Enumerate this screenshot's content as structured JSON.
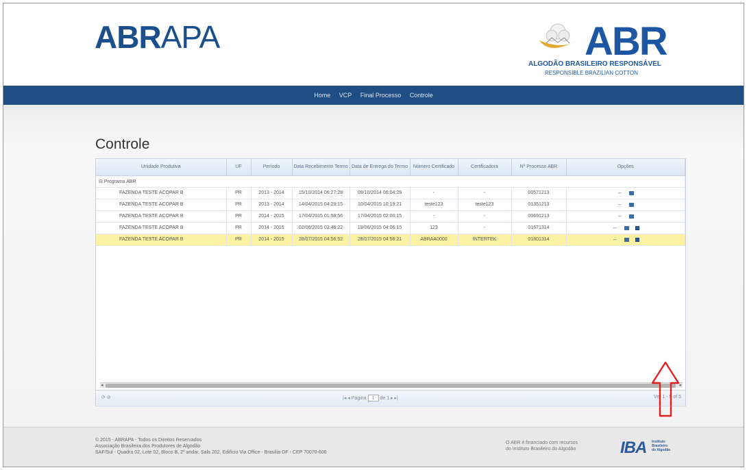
{
  "header": {
    "abrapa_logo_bold": "ABR",
    "abrapa_logo_rest": "APA",
    "abr_logo": "ABR",
    "abr_subtitle": "ALGODÃO BRASILEIRO RESPONSÁVEL",
    "abr_subtitle_en": "RESPONSIBLE BRAZILIAN COTTON"
  },
  "nav": {
    "items": [
      "Home",
      "VCP",
      "Final Processo",
      "Controle"
    ]
  },
  "main": {
    "title": "Controle"
  },
  "grid": {
    "columns": [
      "Unidade Produtiva",
      "UF",
      "Período",
      "Data Recebimento Termo",
      "Data de Entrega do Termo",
      "Número Certificado",
      "Certificadora",
      "Nº Processo ABR",
      "Opções"
    ],
    "group_label": "Programa ABR",
    "rows": [
      [
        "FAZENDA TESTE ACOPAR B",
        "PR",
        "2013 - 2014",
        "15/10/2014 06:27:28",
        "09/10/2014 06:04:29",
        "-",
        "-",
        "00571213"
      ],
      [
        "FAZENDA TESTE ACOPAR B",
        "PR",
        "2013 - 2014",
        "14/04/2015 04:29:15",
        "10/04/2015 10:19:21",
        "teste123",
        "teste123",
        "01351213"
      ],
      [
        "FAZENDA TESTE ACOPAR B",
        "PR",
        "2014 - 2015",
        "17/04/2015 01:58:56",
        "17/04/2015 02:00:15",
        "-",
        "-",
        "00691213"
      ],
      [
        "FAZENDA TESTE ACOPAR B",
        "PR",
        "2014 - 2015",
        "02/06/2015 02:46:22",
        "19/06/2015 04:06:15",
        "123",
        "-",
        "01671314"
      ],
      [
        "FAZENDA TESTE ACOPAR B",
        "PR",
        "2014 - 2015",
        "28/07/2015 04:56:52",
        "28/07/2015 04:58:21",
        "ABRAA0000",
        "INTERTEK",
        "01801314"
      ]
    ],
    "selected_row": 4,
    "pager": {
      "page_label": "Página",
      "page_value": "1",
      "of_label": "de 1",
      "view_label": "Ver 1 - 5 of 5"
    }
  },
  "footer": {
    "line1": "© 2015 - ABRAPA - Todos os Direitos Reservados",
    "line2": "Associação Brasileira dos Produtores de Algodão",
    "line3": "SAF/Sul - Quadra 02, Lote 02, Bloco B, 2º andar, Sala 202, Edifício Via Office - Brasília-DF - CEP 70070-600",
    "right_line1": "O ABR é financiado com recursos",
    "right_line2": "do Instituto Brasileiro do Algodão",
    "iba_logo": "IBA",
    "iba_sub": [
      "Instituto",
      "Brasileiro",
      "do Algodão"
    ]
  },
  "colors": {
    "nav_bg": "#1f4d84",
    "brand_blue": "#1d57a3",
    "selected_row": "#fbf3a3",
    "arrow": "#e02020"
  }
}
